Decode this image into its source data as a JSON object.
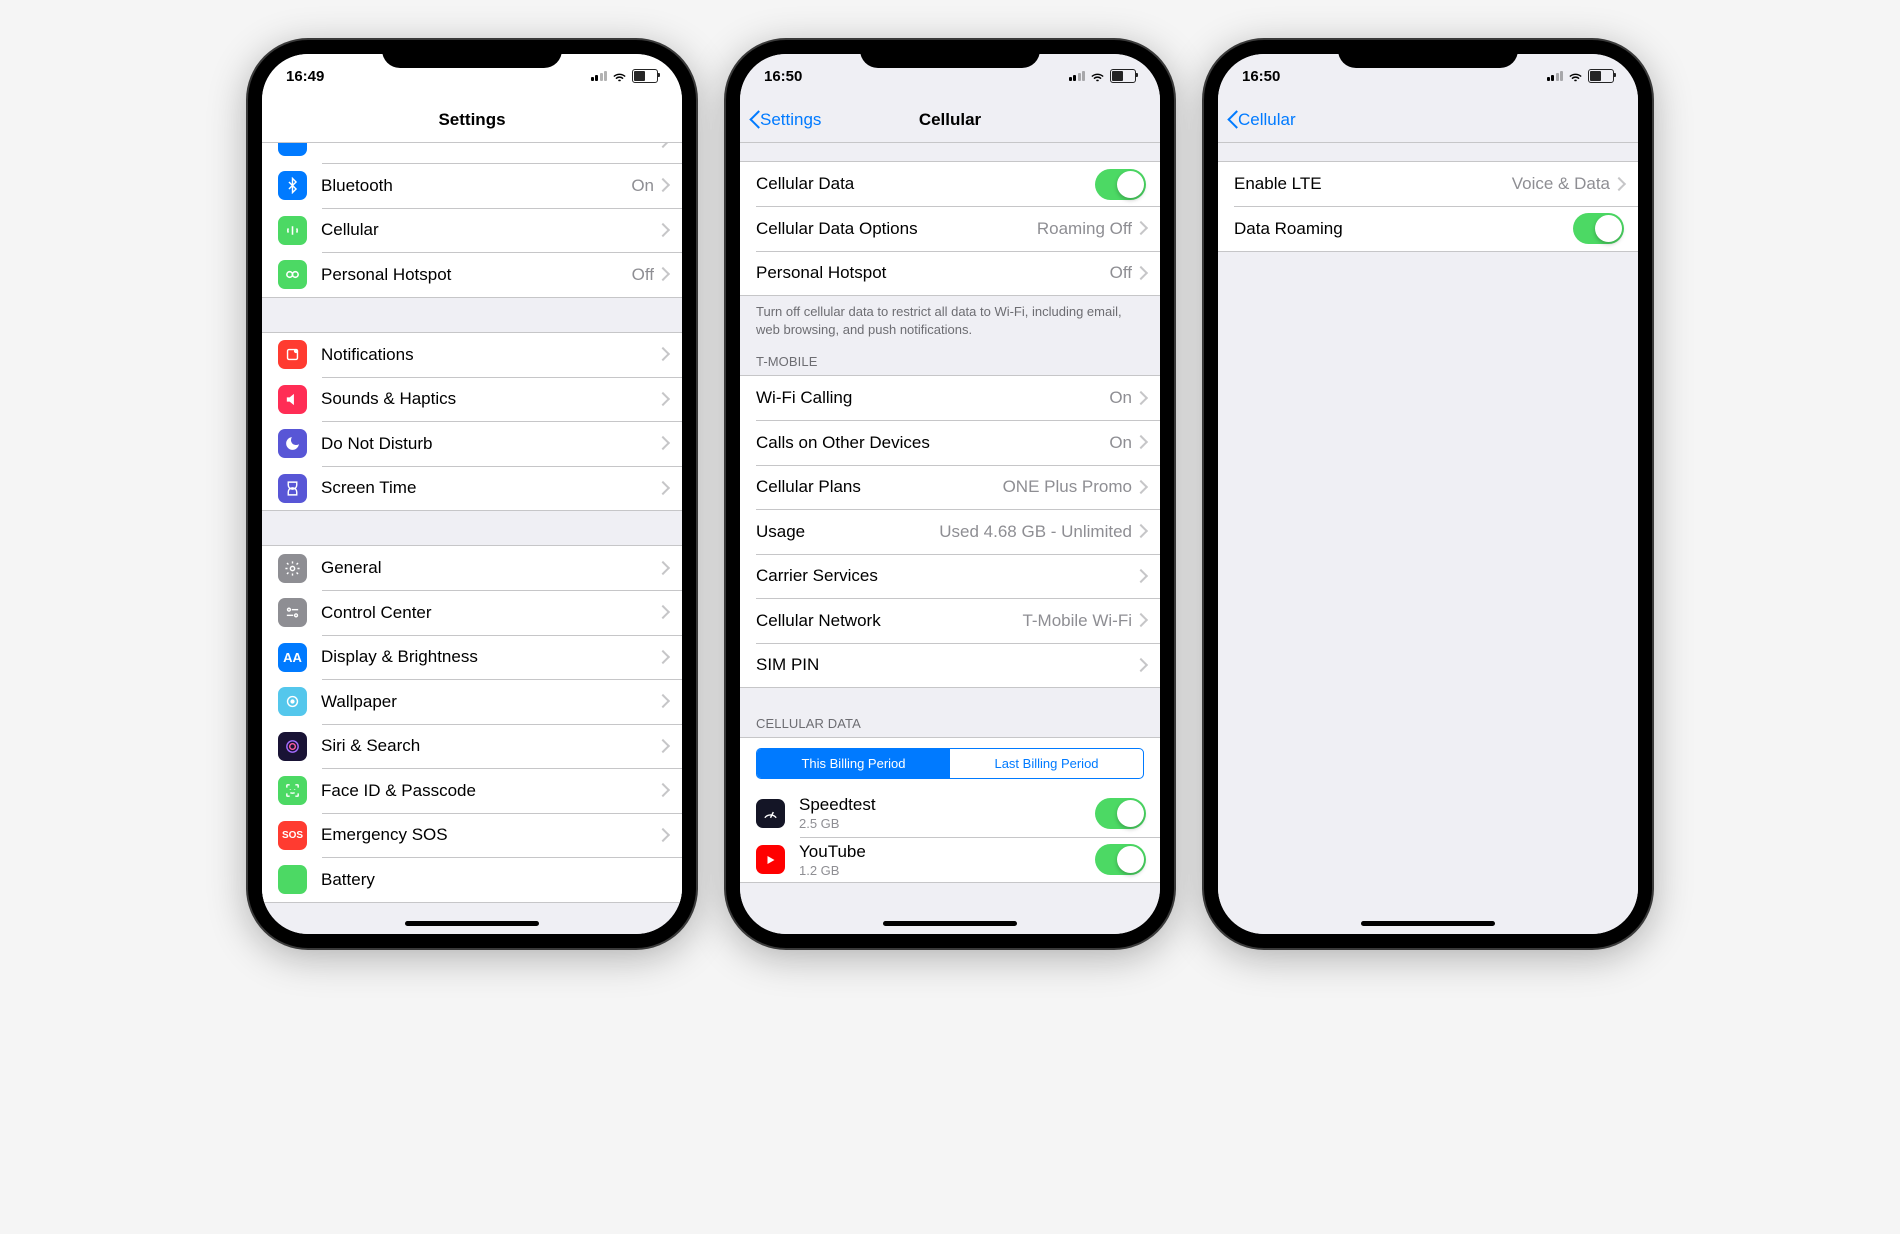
{
  "screen1": {
    "time": "16:49",
    "title": "Settings",
    "group1": [
      {
        "icon": "bluetooth",
        "label": "Bluetooth",
        "value": "On"
      },
      {
        "icon": "cellular",
        "label": "Cellular",
        "value": ""
      },
      {
        "icon": "hotspot",
        "label": "Personal Hotspot",
        "value": "Off"
      }
    ],
    "group2": [
      {
        "icon": "notifications",
        "label": "Notifications"
      },
      {
        "icon": "sounds",
        "label": "Sounds & Haptics"
      },
      {
        "icon": "dnd",
        "label": "Do Not Disturb"
      },
      {
        "icon": "screentime",
        "label": "Screen Time"
      }
    ],
    "group3": [
      {
        "icon": "general",
        "label": "General"
      },
      {
        "icon": "control",
        "label": "Control Center"
      },
      {
        "icon": "display",
        "label": "Display & Brightness"
      },
      {
        "icon": "wallpaper",
        "label": "Wallpaper"
      },
      {
        "icon": "siri",
        "label": "Siri & Search"
      },
      {
        "icon": "faceid",
        "label": "Face ID & Passcode"
      },
      {
        "icon": "sos",
        "label": "Emergency SOS"
      },
      {
        "icon": "battery",
        "label": "Battery"
      }
    ]
  },
  "screen2": {
    "time": "16:50",
    "back": "Settings",
    "title": "Cellular",
    "group1": [
      {
        "label": "Cellular Data",
        "toggle": true
      },
      {
        "label": "Cellular Data Options",
        "value": "Roaming Off",
        "chevron": true
      },
      {
        "label": "Personal Hotspot",
        "value": "Off",
        "chevron": true
      }
    ],
    "footer1": "Turn off cellular data to restrict all data to Wi-Fi, including email, web browsing, and push notifications.",
    "header2": "T-MOBILE",
    "group2": [
      {
        "label": "Wi-Fi Calling",
        "value": "On",
        "chevron": true
      },
      {
        "label": "Calls on Other Devices",
        "value": "On",
        "chevron": true
      },
      {
        "label": "Cellular Plans",
        "value": "ONE Plus Promo",
        "chevron": true
      },
      {
        "label": "Usage",
        "value": "Used 4.68 GB - Unlimited",
        "chevron": true
      },
      {
        "label": "Carrier Services",
        "value": "",
        "chevron": true
      },
      {
        "label": "Cellular Network",
        "value": "T-Mobile Wi-Fi",
        "chevron": true
      },
      {
        "label": "SIM PIN",
        "value": "",
        "chevron": true
      }
    ],
    "header3": "CELLULAR DATA",
    "seg1": "This Billing Period",
    "seg2": "Last Billing Period",
    "apps": [
      {
        "icon": "speedtest",
        "name": "Speedtest",
        "detail": "2.5 GB"
      },
      {
        "icon": "youtube",
        "name": "YouTube",
        "detail": "1.2 GB"
      }
    ]
  },
  "screen3": {
    "time": "16:50",
    "back": "Cellular",
    "group1": [
      {
        "label": "Enable LTE",
        "value": "Voice & Data",
        "chevron": true
      },
      {
        "label": "Data Roaming",
        "toggle": true
      }
    ]
  }
}
